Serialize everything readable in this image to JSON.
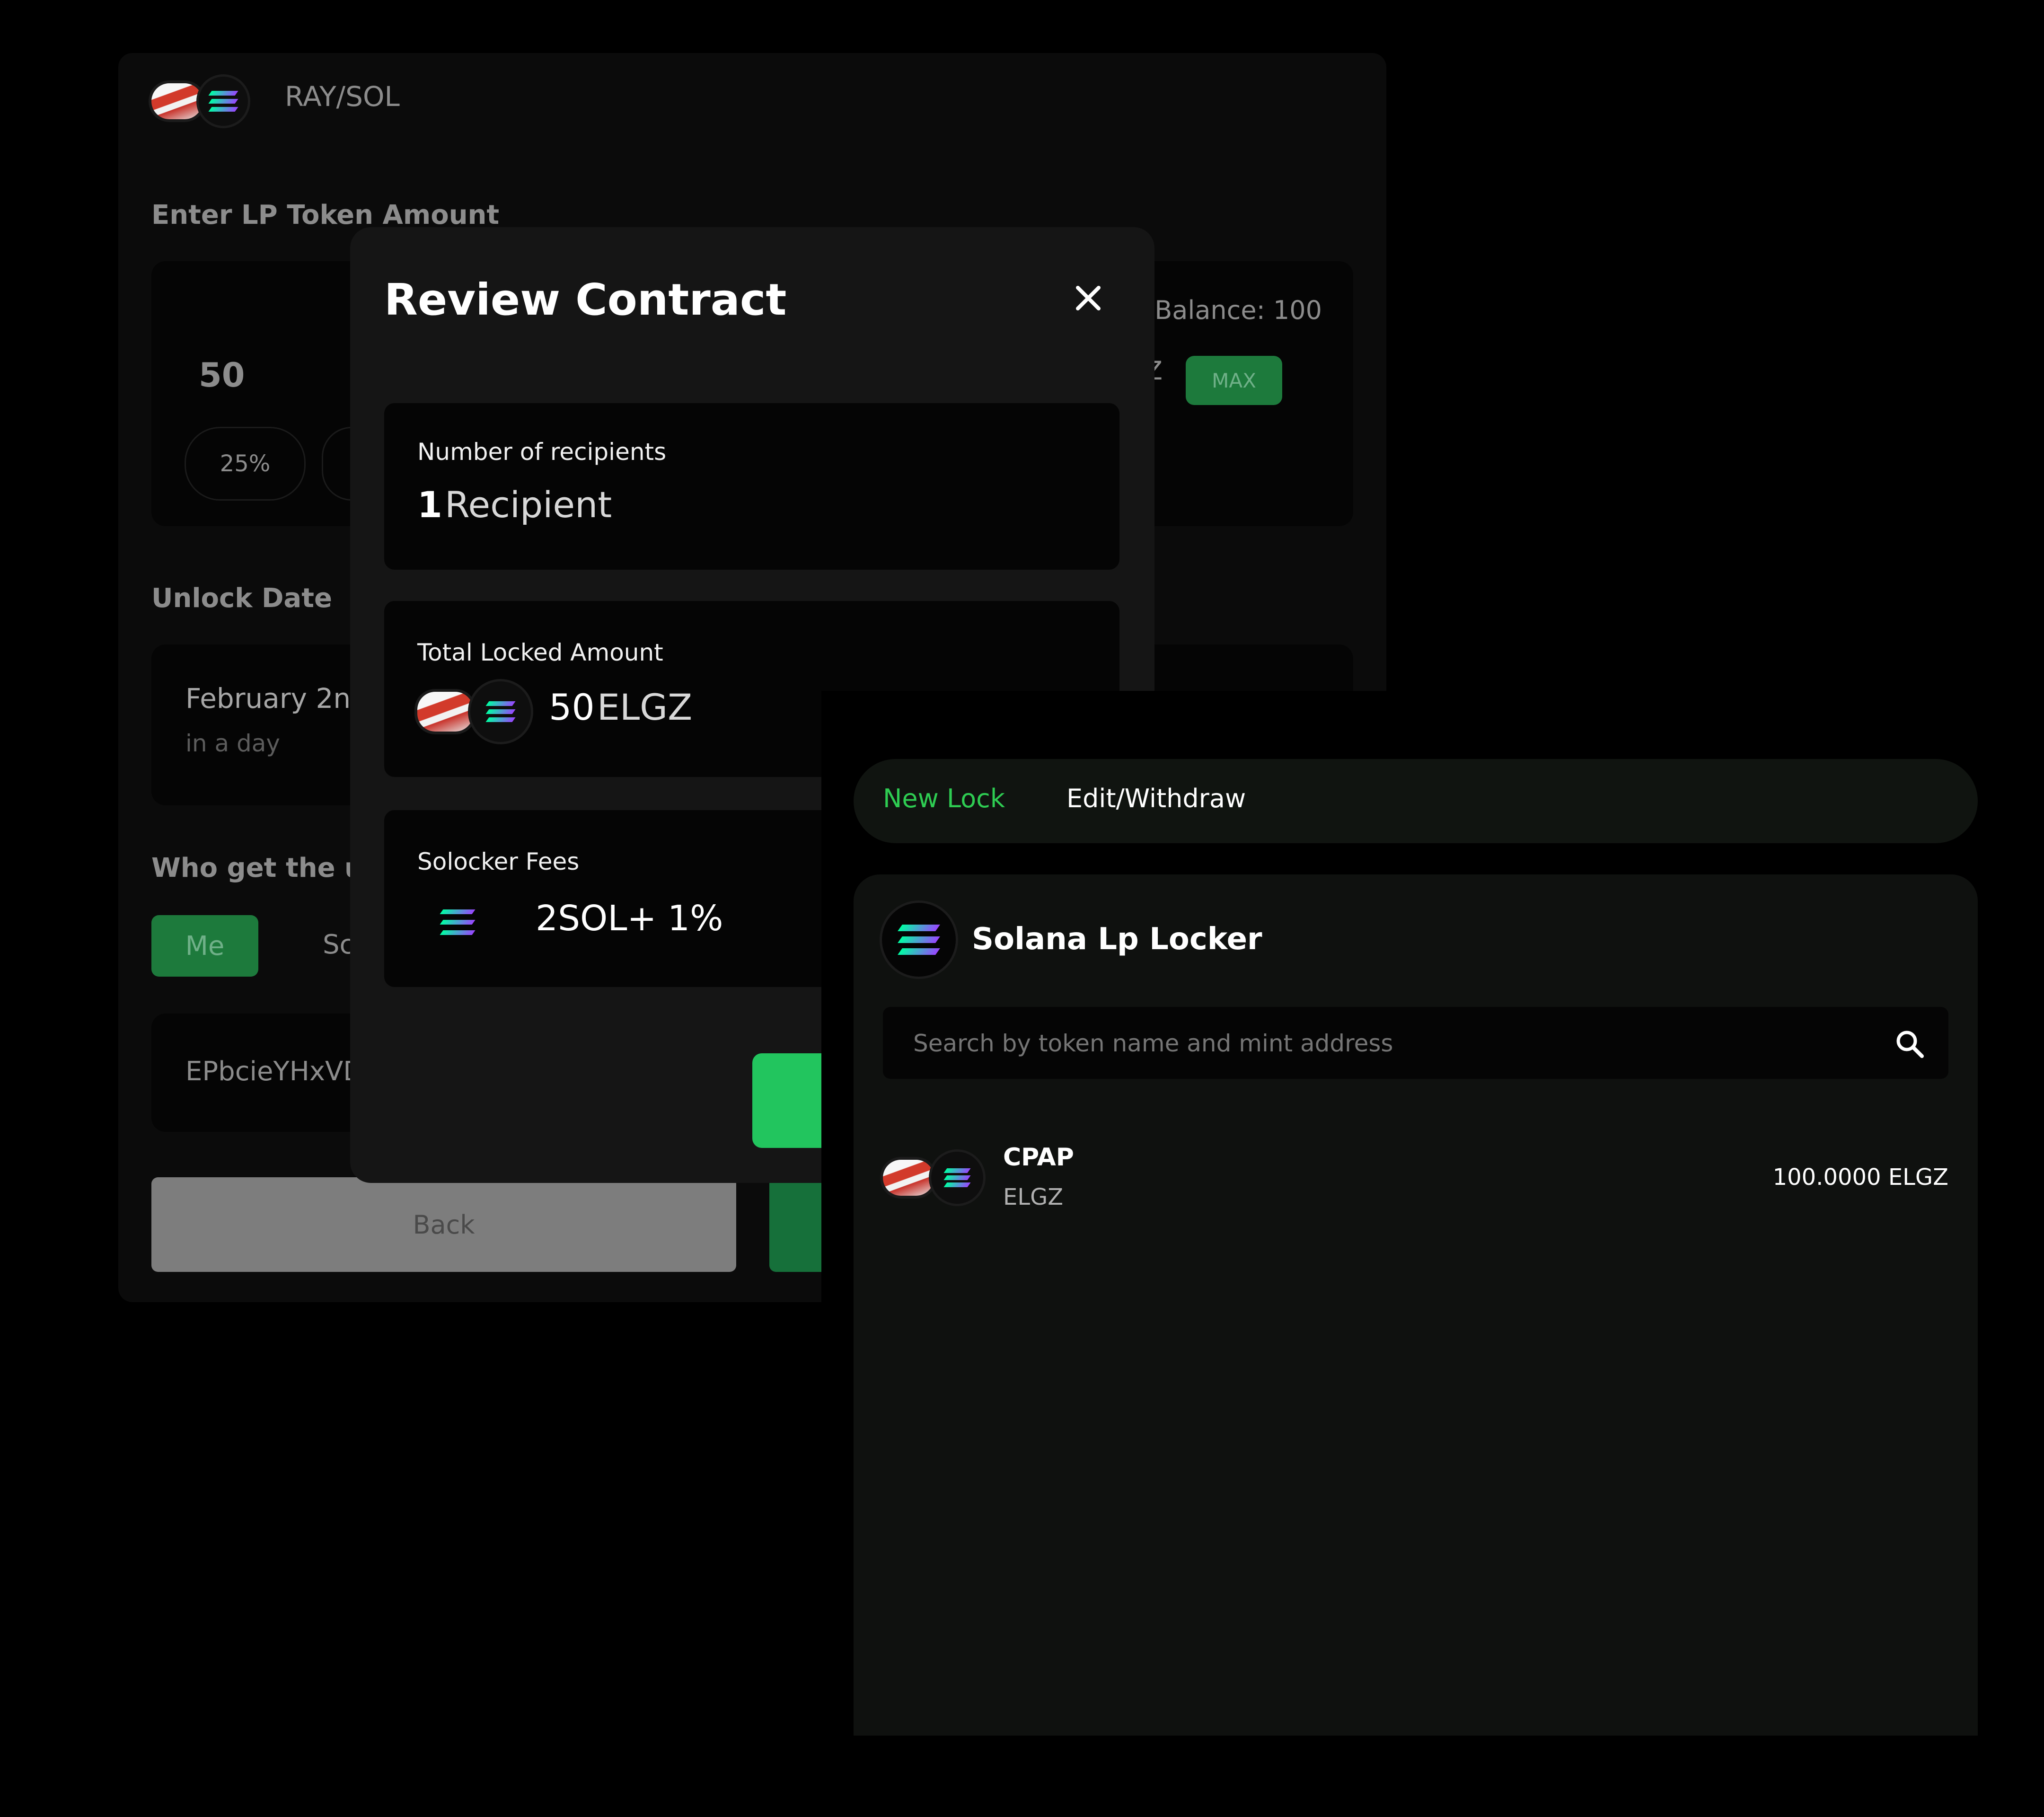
{
  "background_form": {
    "pair_name": "RAY/SOL",
    "lp_label": "Enter LP Token Amount",
    "amount": "50",
    "balance": "Balance: 100",
    "token_suffix_partial": "Z",
    "max_label": "MAX",
    "percent_25": "25%",
    "unlock_label": "Unlock Date",
    "unlock_date": "February 2nc",
    "unlock_relative": "in a day",
    "recipient_label": "Who get the ur",
    "me_label": "Me",
    "someone_label_partial": "Sc",
    "address_partial": "EPbcieYHxVD",
    "back_label": "Back"
  },
  "modal": {
    "title": "Review Contract",
    "recipients_label": "Number of recipients",
    "recipients_count": "1",
    "recipients_unit": "Recipient",
    "locked_label": "Total Locked Amount",
    "locked_amount": "50",
    "locked_token": "ELGZ",
    "fees_label": "Solocker Fees",
    "fees_value": "2SOL+ 1%"
  },
  "front": {
    "tabs": [
      {
        "label": "New Lock",
        "active": true
      },
      {
        "label": "Edit/Withdraw",
        "active": false
      }
    ],
    "panel_title": "Solana Lp Locker",
    "search_placeholder": "Search by token name and mint address",
    "tokens": [
      {
        "name": "CPAP",
        "symbol": "ELGZ",
        "balance": "100.0000 ELGZ"
      }
    ]
  },
  "colors": {
    "accent_green": "#1fa84a",
    "bright_green": "#22c55e",
    "tab_active_green": "#2ecc52",
    "background": "#000000"
  },
  "icons": [
    "ray-token-icon",
    "solana-icon",
    "close-icon",
    "search-icon"
  ]
}
